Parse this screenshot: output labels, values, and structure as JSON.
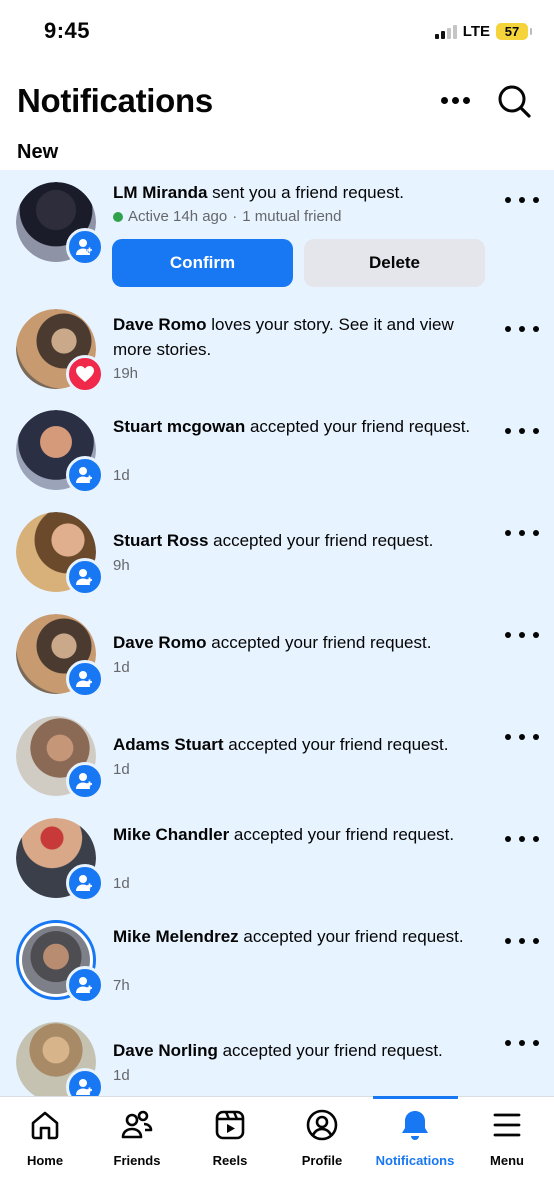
{
  "status_bar": {
    "time": "9:45",
    "network": "LTE",
    "battery": "57",
    "battery_color": "#f5d33a"
  },
  "header": {
    "title": "Notifications"
  },
  "section_label": "New",
  "colors": {
    "accent": "#1877f2",
    "unread_bg": "#e7f3ff",
    "love": "#f02849",
    "active_green": "#31a24c"
  },
  "friend_request": {
    "name": "LM Miranda",
    "text": " sent you a friend request.",
    "active": "Active 14h ago",
    "separator": " · ",
    "mutual": "1 mutual friend",
    "confirm_label": "Confirm",
    "delete_label": "Delete"
  },
  "notifications": [
    {
      "name": "Dave Romo",
      "text": " loves your story. See it and view more stories.",
      "time": "19h",
      "badge": "heart-icon"
    },
    {
      "name": "Stuart mcgowan",
      "text": " accepted your friend request.",
      "time": "1d",
      "badge": "friend-add-icon"
    },
    {
      "name": "Stuart Ross",
      "text": " accepted your friend request.",
      "time": "9h",
      "badge": "friend-add-icon"
    },
    {
      "name": "Dave Romo",
      "text": " accepted your friend request.",
      "time": "1d",
      "badge": "friend-add-icon"
    },
    {
      "name": "Adams Stuart",
      "text": " accepted your friend request.",
      "time": "1d",
      "badge": "friend-add-icon"
    },
    {
      "name": "Mike Chandler",
      "text": " accepted your friend request.",
      "time": "1d",
      "badge": "friend-add-icon"
    },
    {
      "name": "Mike Melendrez",
      "text": " accepted your friend request.",
      "time": "7h",
      "badge": "friend-add-icon"
    },
    {
      "name": "Dave Norling",
      "text": " accepted your friend request.",
      "time": "1d",
      "badge": "friend-add-icon"
    }
  ],
  "bottom_nav": [
    {
      "label": "Home",
      "icon": "home-icon"
    },
    {
      "label": "Friends",
      "icon": "friends-icon"
    },
    {
      "label": "Reels",
      "icon": "reels-icon"
    },
    {
      "label": "Profile",
      "icon": "profile-icon"
    },
    {
      "label": "Notifications",
      "icon": "bell-icon",
      "active": true
    },
    {
      "label": "Menu",
      "icon": "menu-icon"
    }
  ]
}
